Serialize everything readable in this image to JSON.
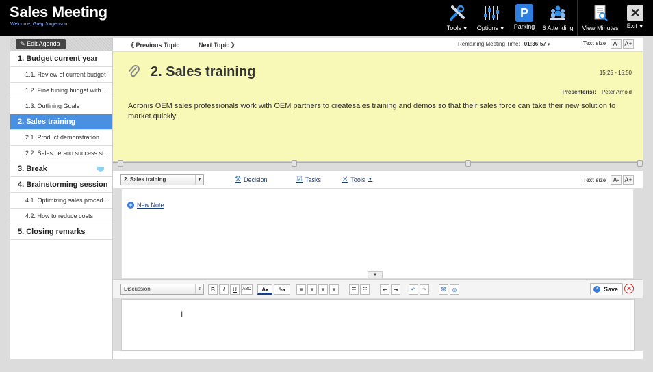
{
  "header": {
    "title": "Sales Meeting",
    "welcome": "Welcome, Greg Jorgenson",
    "buttons": {
      "tools": "Tools",
      "options": "Options",
      "parking": "Parking",
      "attending": "6 Attending",
      "view_minutes": "View Minutes",
      "exit": "Exit"
    },
    "parking_letter": "P",
    "exit_glyph": "✕"
  },
  "sidebar": {
    "edit_agenda": "Edit Agenda",
    "items": [
      {
        "label": "1. Budget current year",
        "level": "top"
      },
      {
        "label": "1.1. Review of current budget",
        "level": "sub"
      },
      {
        "label": "1.2. Fine tuning budget with ...",
        "level": "sub"
      },
      {
        "label": "1.3. Outlining Goals",
        "level": "sub"
      },
      {
        "label": "2. Sales training",
        "level": "top",
        "active": true
      },
      {
        "label": "2.1. Product demonstration",
        "level": "sub"
      },
      {
        "label": "2.2. Sales person success st...",
        "level": "sub"
      },
      {
        "label": "3. Break",
        "level": "top"
      },
      {
        "label": "4. Brainstorming session",
        "level": "top"
      },
      {
        "label": "4.1. Optimizing sales proced...",
        "level": "sub"
      },
      {
        "label": "4.2. How to reduce costs",
        "level": "sub"
      },
      {
        "label": "5. Closing remarks",
        "level": "top"
      }
    ]
  },
  "topnav": {
    "previous": "Previous Topic",
    "next": "Next Topic",
    "remaining_label": "Remaining Meeting Time:",
    "remaining_value": "01:36:57",
    "text_size": "Text size",
    "smaller": "A-",
    "larger": "A+"
  },
  "topic": {
    "title": "2. Sales training",
    "time": "15:25 - 15:50",
    "presenter_label": "Presenter(s):",
    "presenter": "Peter Arnold",
    "description": "Acronis OEM sales professionals work with OEM partners to createsales training and demos so that their sales force can take their new solution to market quickly."
  },
  "midbar": {
    "topic_select": "2. Sales training",
    "decision": "Decision",
    "tasks": "Tasks",
    "tools": "Tools",
    "text_size": "Text size",
    "smaller": "A-",
    "larger": "A+"
  },
  "notes": {
    "new_note": "New Note"
  },
  "editor": {
    "type_select": "Discussion",
    "save": "Save",
    "bold": "B",
    "italic": "I",
    "underline": "U",
    "strike": "ABC",
    "font_color": "A"
  },
  "colors": {
    "header_bg": "#000000",
    "active_item": "#4a90e2",
    "topic_bg": "#f8f9b7",
    "link": "#1a3f7a"
  }
}
